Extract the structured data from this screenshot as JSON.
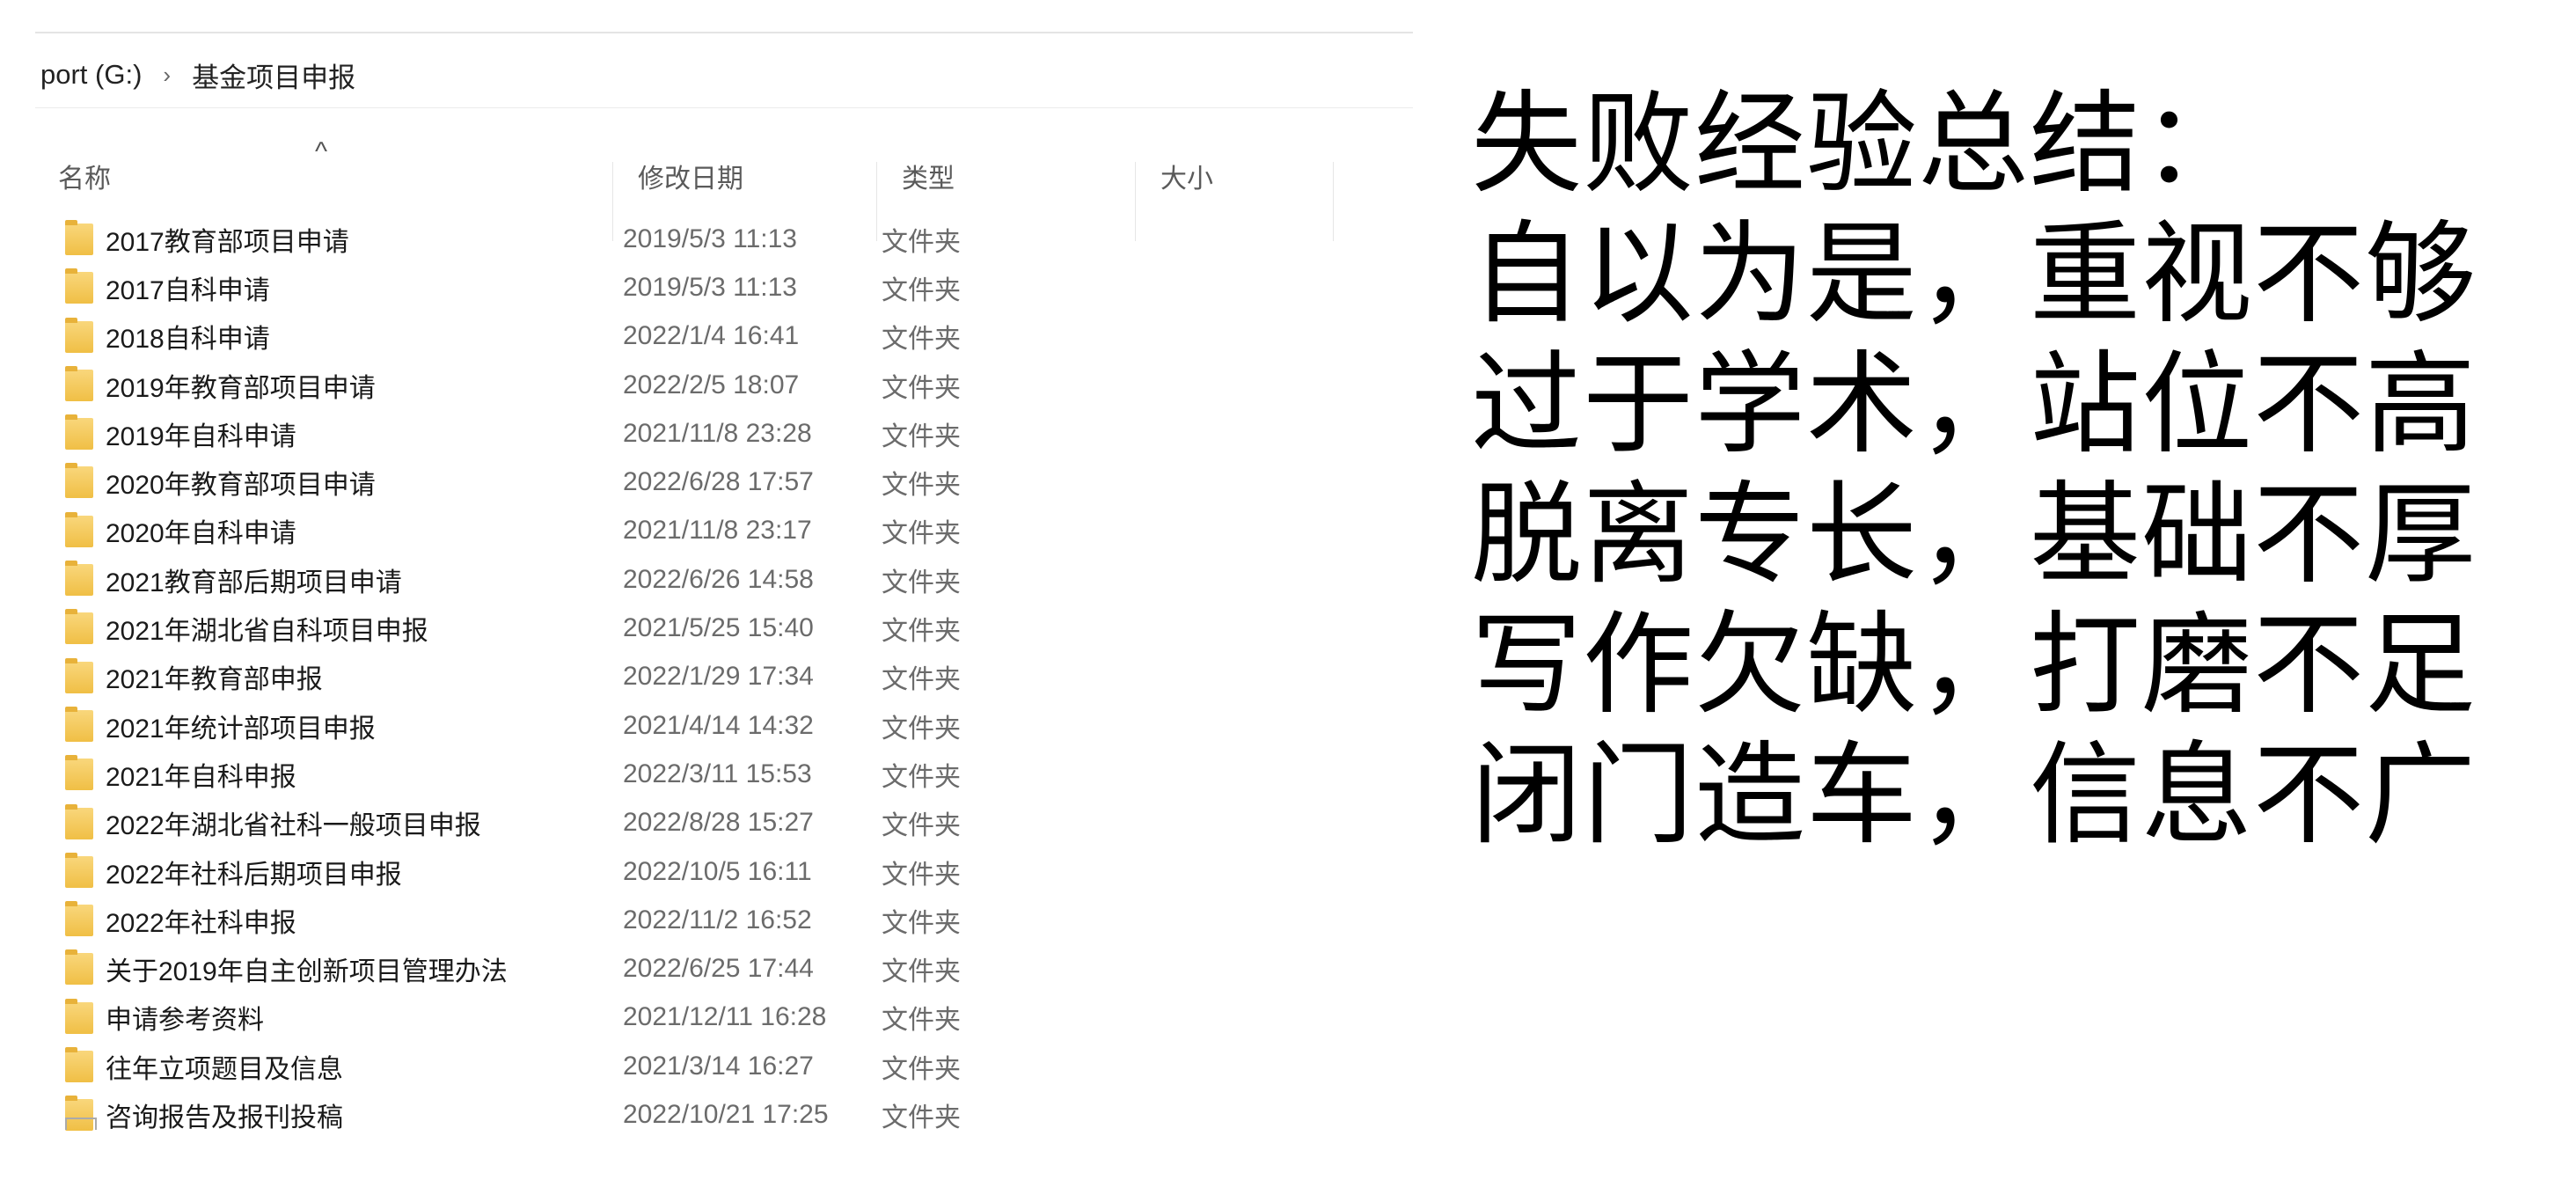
{
  "address": {
    "drive": "port (G:)",
    "separator": "›",
    "folder": "基金项目申报"
  },
  "columns": {
    "name": "名称",
    "date": "修改日期",
    "type": "类型",
    "size": "大小",
    "sort_indicator": "^"
  },
  "files": [
    {
      "name": "2017教育部项目申请",
      "date": "2019/5/3 11:13",
      "type": "文件夹"
    },
    {
      "name": "2017自科申请",
      "date": "2019/5/3 11:13",
      "type": "文件夹"
    },
    {
      "name": "2018自科申请",
      "date": "2022/1/4 16:41",
      "type": "文件夹"
    },
    {
      "name": "2019年教育部项目申请",
      "date": "2022/2/5 18:07",
      "type": "文件夹"
    },
    {
      "name": "2019年自科申请",
      "date": "2021/11/8 23:28",
      "type": "文件夹"
    },
    {
      "name": "2020年教育部项目申请",
      "date": "2022/6/28 17:57",
      "type": "文件夹"
    },
    {
      "name": "2020年自科申请",
      "date": "2021/11/8 23:17",
      "type": "文件夹"
    },
    {
      "name": "2021教育部后期项目申请",
      "date": "2022/6/26 14:58",
      "type": "文件夹"
    },
    {
      "name": "2021年湖北省自科项目申报",
      "date": "2021/5/25 15:40",
      "type": "文件夹"
    },
    {
      "name": "2021年教育部申报",
      "date": "2022/1/29 17:34",
      "type": "文件夹"
    },
    {
      "name": "2021年统计部项目申报",
      "date": "2021/4/14 14:32",
      "type": "文件夹"
    },
    {
      "name": "2021年自科申报",
      "date": "2022/3/11 15:53",
      "type": "文件夹"
    },
    {
      "name": "2022年湖北省社科一般项目申报",
      "date": "2022/8/28 15:27",
      "type": "文件夹"
    },
    {
      "name": "2022年社科后期项目申报",
      "date": "2022/10/5 16:11",
      "type": "文件夹"
    },
    {
      "name": "2022年社科申报",
      "date": "2022/11/2 16:52",
      "type": "文件夹"
    },
    {
      "name": "关于2019年自主创新项目管理办法",
      "date": "2022/6/25 17:44",
      "type": "文件夹"
    },
    {
      "name": "申请参考资料",
      "date": "2021/12/11 16:28",
      "type": "文件夹"
    },
    {
      "name": "往年立项题目及信息",
      "date": "2021/3/14 16:27",
      "type": "文件夹"
    },
    {
      "name": "咨询报告及报刊投稿",
      "date": "2022/10/21 17:25",
      "type": "文件夹"
    }
  ],
  "summary": {
    "title": "失败经验总结：",
    "lines": [
      "自以为是，重视不够",
      "过于学术，站位不高",
      "脱离专长，基础不厚",
      "写作欠缺，打磨不足",
      "闭门造车，信息不广"
    ]
  },
  "colors": {
    "folder": "#f0bf45",
    "text_primary": "#1a1a1a",
    "text_secondary": "#6b6b6b"
  }
}
